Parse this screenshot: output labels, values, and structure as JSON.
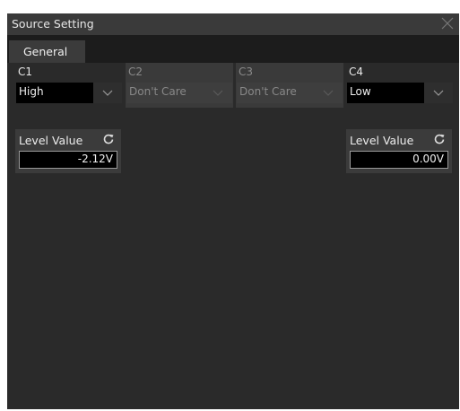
{
  "dialog": {
    "title": "Source Setting"
  },
  "tabs": [
    {
      "label": "General",
      "active": true
    }
  ],
  "channels": [
    {
      "name": "C1",
      "value": "High",
      "enabled": true
    },
    {
      "name": "C2",
      "value": "Don't Care",
      "enabled": false
    },
    {
      "name": "C3",
      "value": "Don't Care",
      "enabled": false
    },
    {
      "name": "C4",
      "value": "Low",
      "enabled": true
    }
  ],
  "levels": [
    {
      "label": "Level Value",
      "value": "-2.12V"
    },
    {
      "label": "Level Value",
      "value": "0.00V"
    }
  ],
  "icons": {
    "close": "close-icon",
    "reset": "reset-icon",
    "dropdown": "chevron-down-icon"
  },
  "colors": {
    "background": "#000000",
    "panel": "#2a2a2a",
    "titlebar": "#3a3a3a",
    "tab_active": "#3b3b3b",
    "disabled": "#3a3a3a"
  }
}
